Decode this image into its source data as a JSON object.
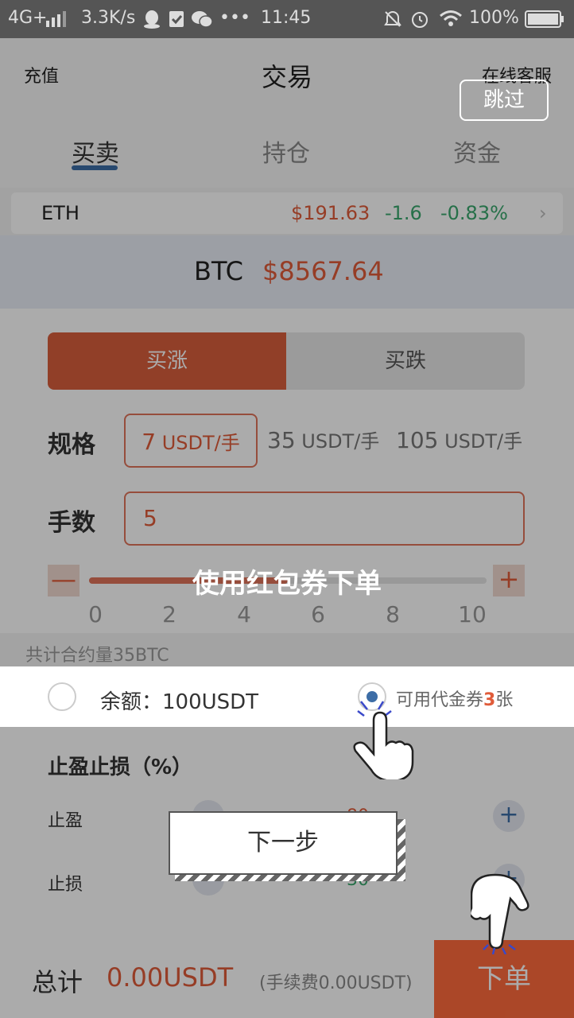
{
  "statusbar": {
    "network": "4G+",
    "speed": "3.3K/s",
    "time": "11:45",
    "battery": "100%"
  },
  "header": {
    "left": "充值",
    "title": "交易",
    "right": "在线客服"
  },
  "tabs": [
    "买卖",
    "持仓",
    "资金"
  ],
  "ticker": {
    "symbol": "ETH",
    "price": "$191.63",
    "change": "-1.6",
    "change_pct": "-0.83%"
  },
  "btc": {
    "symbol": "BTC",
    "price": "$8567.64"
  },
  "trade": {
    "buy_label": "买涨",
    "sell_label": "买跌",
    "spec_label": "规格",
    "specs": [
      {
        "num": "7",
        "unit": "USDT/手"
      },
      {
        "num": "35",
        "unit": "USDT/手"
      },
      {
        "num": "105",
        "unit": "USDT/手"
      }
    ],
    "qty_label": "手数",
    "qty_value": "5",
    "slider_minus": "—",
    "slider_plus": "+",
    "slider_ticks": [
      "0",
      "2",
      "4",
      "6",
      "8",
      "10"
    ],
    "slider_value": 5,
    "slider_max": 10,
    "total_contract": "共计合约量35BTC"
  },
  "payment": {
    "balance": "余额：100USDT",
    "coupon_prefix": "可用代金券",
    "coupon_count": "3",
    "coupon_suffix": "张"
  },
  "stop": {
    "title": "止盈止损（%）",
    "take_profit": "止盈",
    "take_profit_value": "80",
    "stop_loss": "止损",
    "stop_loss_value": "30"
  },
  "bottom": {
    "total_label": "总计",
    "total_value": "0.00USDT",
    "fee": "(手续费0.00USDT)",
    "order": "下单"
  },
  "guide": {
    "skip": "跳过",
    "title": "使用红包券下单",
    "next": "下一步"
  },
  "colors": {
    "accent": "#e05c3a",
    "order": "#ff6b3d",
    "blue": "#3d6da6",
    "green": "#3aa76d"
  }
}
